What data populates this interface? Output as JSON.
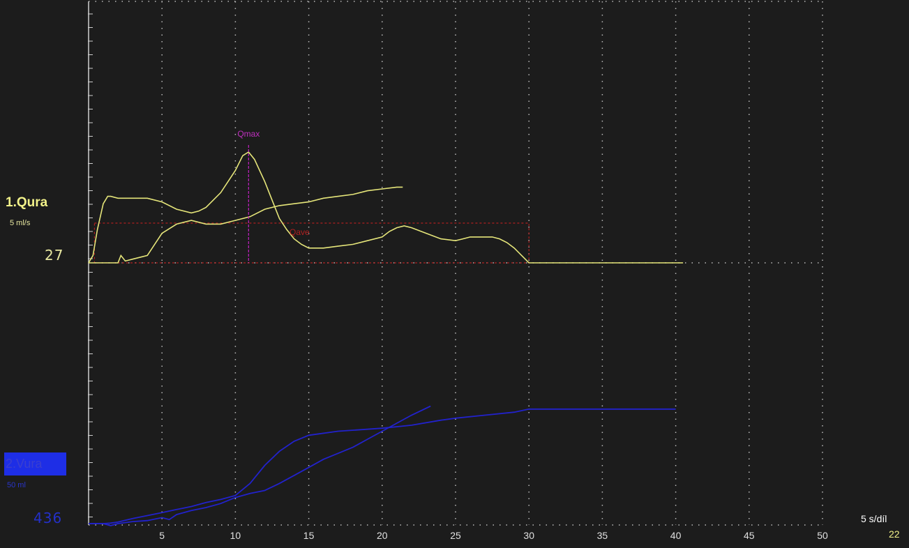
{
  "chart_data": {
    "type": "line",
    "x_ticks": [
      5,
      10,
      15,
      20,
      25,
      30,
      35,
      40,
      45,
      50
    ],
    "xlim": [
      0,
      50
    ],
    "timebase_label": "5 s/díl",
    "page_number": "22",
    "grid": true,
    "channels": [
      {
        "label": "1.Qura",
        "unit": "5 ml/s",
        "value": "27",
        "color": "#e6e67a",
        "markers": {
          "qmax": "Qmax",
          "qave": "Qave",
          "qmax_time": 10.9
        },
        "series": [
          {
            "name": "1.Qura",
            "x": [
              0,
              0.3,
              0.6,
              1.0,
              1.3,
              1.5,
              2.0,
              3.0,
              4.0,
              5.0,
              6.0,
              7.0,
              7.5,
              8.0,
              9.0,
              10.0,
              10.5,
              10.9,
              11.3,
              12.0,
              12.5,
              13.0,
              13.5,
              14.0,
              14.5,
              15.0,
              16.0,
              17.0,
              18.0,
              19.0,
              20.0,
              20.5,
              21.0,
              21.5,
              22.0,
              23.0,
              24.0,
              25.0,
              25.5,
              26.0,
              26.5,
              27.0,
              27.5,
              28.0,
              28.5,
              29.0,
              29.5,
              30.0,
              35.0,
              40.5
            ],
            "y": [
              0,
              2,
              9,
              16,
              18,
              18,
              17.5,
              17.5,
              17.5,
              16.5,
              14.5,
              13.5,
              14,
              15,
              19,
              25,
              29,
              30,
              28,
              22,
              17,
              12,
              9,
              6.5,
              5,
              4,
              4,
              4.5,
              5,
              6,
              7,
              8.5,
              9.5,
              10,
              9.5,
              8,
              6.5,
              6,
              6.5,
              7,
              7,
              7,
              7,
              6.5,
              5.5,
              4,
              2,
              0,
              0,
              0
            ]
          },
          {
            "name": "1.Qura",
            "x": [
              0,
              1.0,
              2.0,
              2.2,
              2.5,
              3.0,
              4.0,
              5.0,
              6.0,
              7.0,
              8.0,
              9.0,
              10.0,
              11.0,
              12.0,
              13.0,
              14.0,
              15.0,
              16.0,
              17.0,
              18.0,
              19.0,
              20.0,
              21.0,
              21.4
            ],
            "y": [
              0,
              0,
              0,
              2,
              0.5,
              1,
              2,
              8,
              10.5,
              11.5,
              10.5,
              10.5,
              11.5,
              12.5,
              14.5,
              15.5,
              16,
              16.5,
              17.5,
              18,
              18.5,
              19.5,
              20,
              20.5,
              20.5
            ]
          }
        ]
      },
      {
        "label": "2.Vura",
        "unit": "50 ml",
        "value": "436",
        "color": "#2222cc",
        "series": [
          {
            "name": "2.Vura",
            "x": [
              0,
              0.5,
              1.0,
              1.5,
              2.0,
              3.0,
              4.0,
              5.0,
              6.0,
              7.0,
              8.0,
              9.0,
              10.0,
              11.0,
              12.0,
              13.0,
              14.0,
              15.0,
              17.0,
              20.0,
              22.0,
              24.0,
              25.0,
              27.0,
              29.0,
              30.0,
              35.0,
              40.0
            ],
            "y": [
              0,
              0,
              0,
              0.5,
              1.5,
              5,
              8,
              11,
              14,
              17,
              21,
              24,
              28,
              40,
              58,
              72,
              82,
              88,
              92,
              95,
              98,
              103,
              105,
              108,
              111,
              114,
              114,
              114
            ]
          },
          {
            "name": "2.Vura",
            "x": [
              0,
              1.0,
              1.5,
              2.0,
              3.0,
              4.0,
              5.0,
              5.5,
              6.0,
              7.0,
              8.0,
              9.0,
              10.0,
              11.0,
              12.0,
              13.0,
              14.0,
              15.0,
              16.0,
              17.0,
              18.0,
              19.0,
              20.0,
              21.0,
              22.0,
              23.3
            ],
            "y": [
              0,
              0,
              -2,
              0,
              2,
              3,
              6,
              4,
              9,
              13,
              16,
              20,
              26,
              30,
              33,
              40,
              48,
              56,
              64,
              70,
              76,
              84,
              92,
              100,
              108,
              117
            ]
          }
        ]
      }
    ]
  }
}
